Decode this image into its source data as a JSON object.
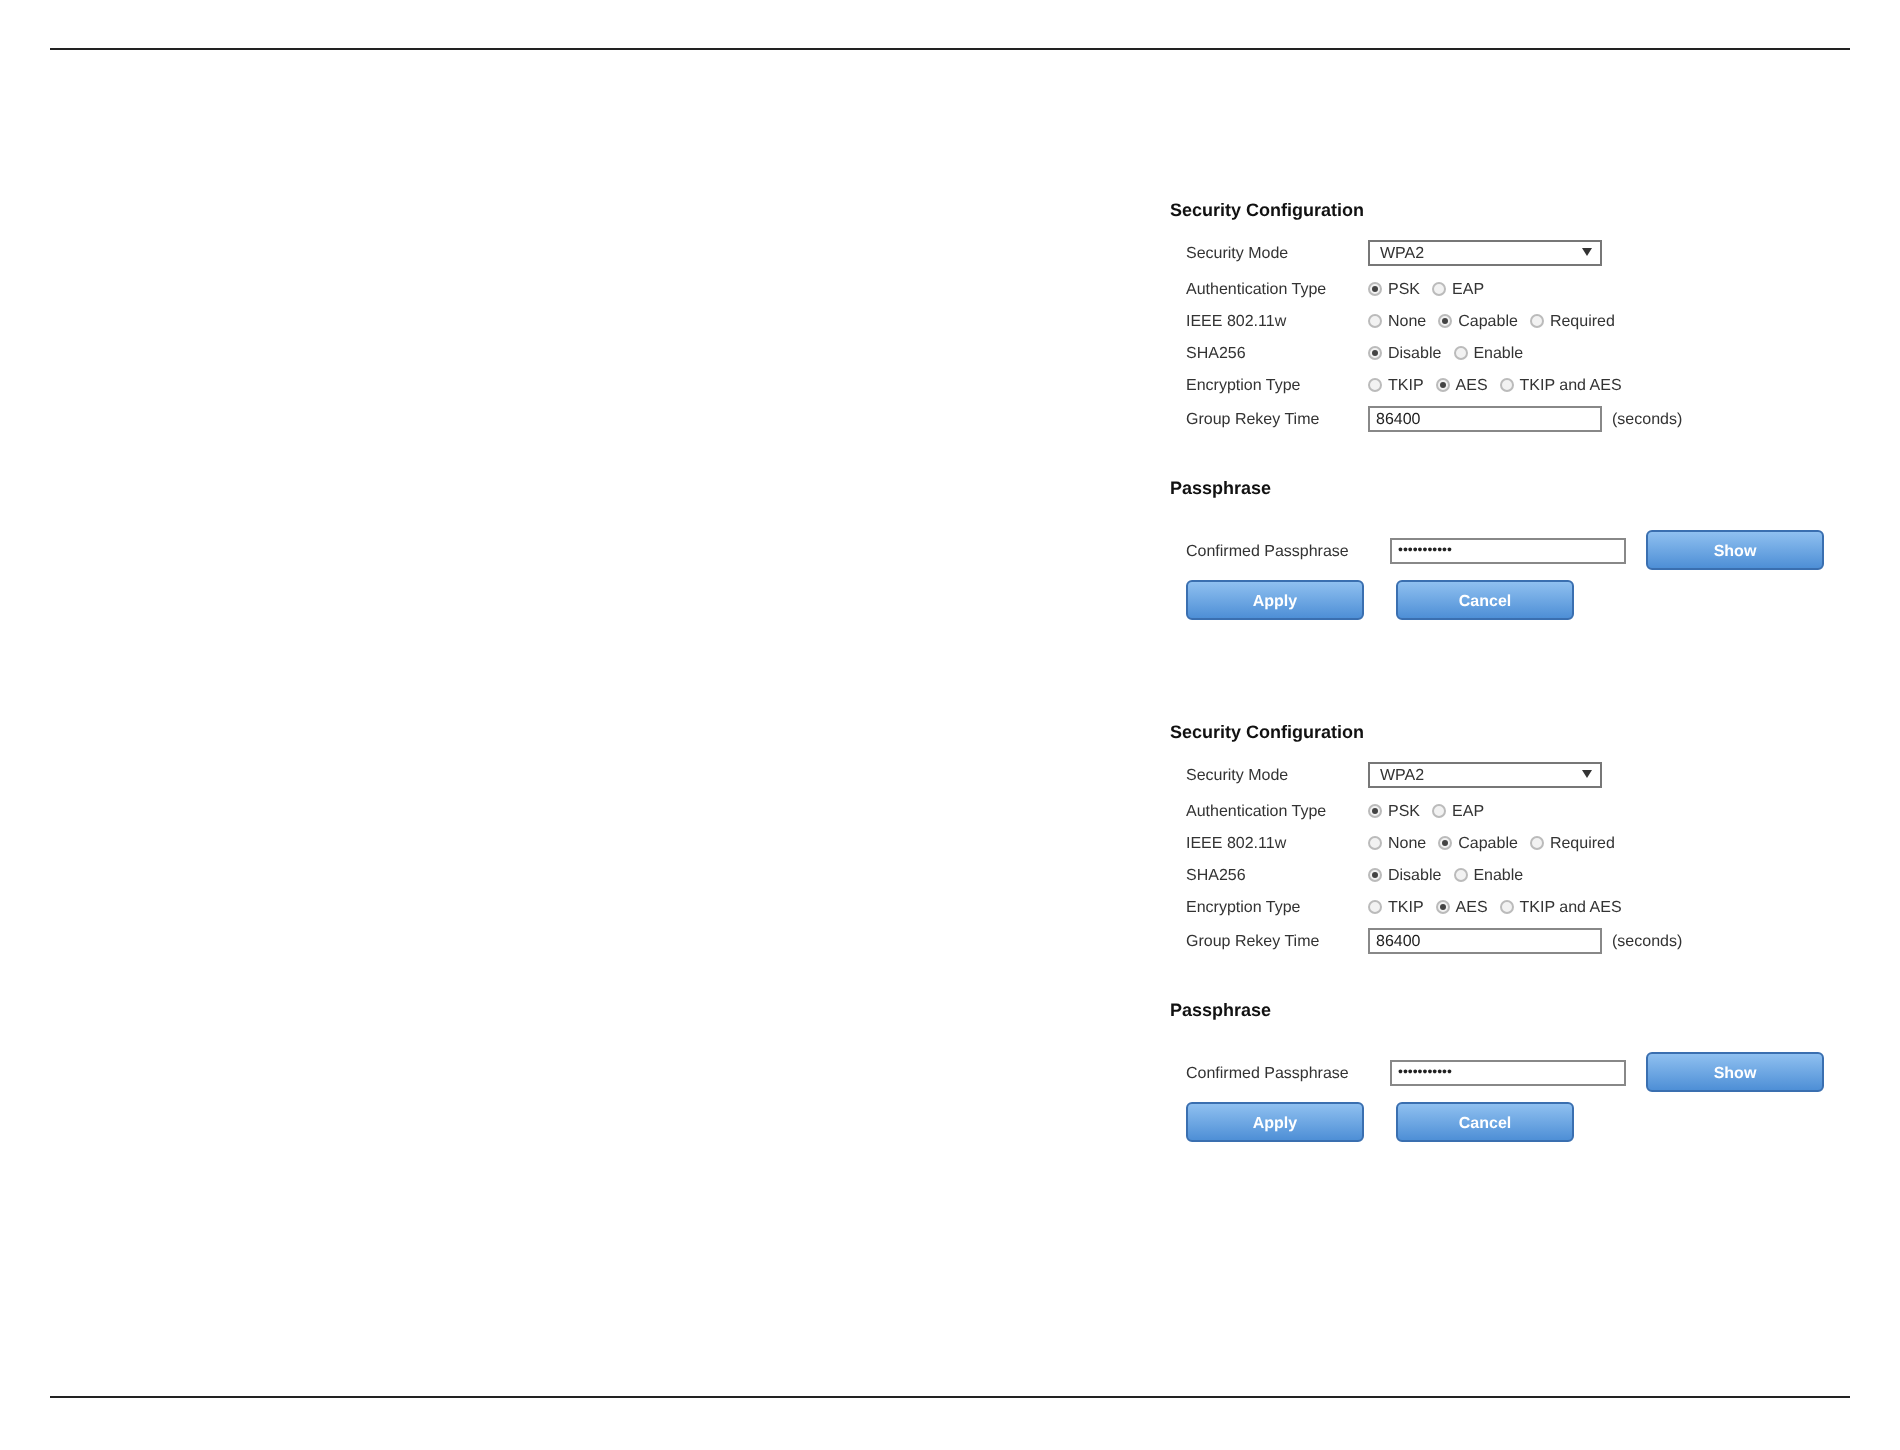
{
  "panels": [
    {
      "title": "Security Configuration",
      "security_mode": {
        "label": "Security Mode",
        "value": "WPA2"
      },
      "radio_groups": [
        {
          "label": "Authentication Type",
          "options": [
            {
              "label": "PSK",
              "selected": true
            },
            {
              "label": "EAP",
              "selected": false
            }
          ]
        },
        {
          "label": "IEEE 802.11w",
          "options": [
            {
              "label": "None",
              "selected": false
            },
            {
              "label": "Capable",
              "selected": true
            },
            {
              "label": "Required",
              "selected": false
            }
          ]
        },
        {
          "label": "SHA256",
          "options": [
            {
              "label": "Disable",
              "selected": true
            },
            {
              "label": "Enable",
              "selected": false
            }
          ]
        },
        {
          "label": "Encryption Type",
          "options": [
            {
              "label": "TKIP",
              "selected": false
            },
            {
              "label": "AES",
              "selected": true
            },
            {
              "label": "TKIP and AES",
              "selected": false
            }
          ]
        }
      ],
      "rekey": {
        "label": "Group Rekey Time",
        "value": "86400",
        "unit": "(seconds)"
      },
      "passphrase_title": "Passphrase",
      "passphrase": {
        "label": "Confirmed Passphrase",
        "value": "•••••••••••",
        "button": "Show"
      },
      "buttons": [
        "Apply",
        "Cancel"
      ]
    },
    {
      "title": "Security Configuration",
      "security_mode": {
        "label": "Security Mode",
        "value": "WPA2"
      },
      "radio_groups": [
        {
          "label": "Authentication Type",
          "options": [
            {
              "label": "PSK",
              "selected": true
            },
            {
              "label": "EAP",
              "selected": false
            }
          ]
        },
        {
          "label": "IEEE 802.11w",
          "options": [
            {
              "label": "None",
              "selected": false
            },
            {
              "label": "Capable",
              "selected": true
            },
            {
              "label": "Required",
              "selected": false
            }
          ]
        },
        {
          "label": "SHA256",
          "options": [
            {
              "label": "Disable",
              "selected": true
            },
            {
              "label": "Enable",
              "selected": false
            }
          ]
        },
        {
          "label": "Encryption Type",
          "options": [
            {
              "label": "TKIP",
              "selected": false
            },
            {
              "label": "AES",
              "selected": true
            },
            {
              "label": "TKIP and AES",
              "selected": false
            }
          ]
        }
      ],
      "rekey": {
        "label": "Group Rekey Time",
        "value": "86400",
        "unit": "(seconds)"
      },
      "passphrase_title": "Passphrase",
      "passphrase": {
        "label": "Confirmed Passphrase",
        "value": "•••••••••••",
        "button": "Show"
      },
      "buttons": [
        "Apply",
        "Cancel"
      ]
    }
  ]
}
